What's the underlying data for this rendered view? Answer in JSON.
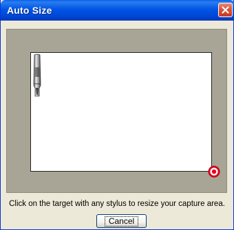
{
  "window": {
    "title": "Auto Size"
  },
  "instruction_text": "Click on the target with any stylus to resize your capture area.",
  "buttons": {
    "cancel_label": "Cancel"
  },
  "icons": {
    "close": "close-icon",
    "stylus": "stylus-icon",
    "target": "target-icon"
  },
  "colors": {
    "titlebar": "#0055e5",
    "panel": "#a9a596",
    "target": "#e8001c",
    "dialog_bg": "#ece9d8"
  }
}
